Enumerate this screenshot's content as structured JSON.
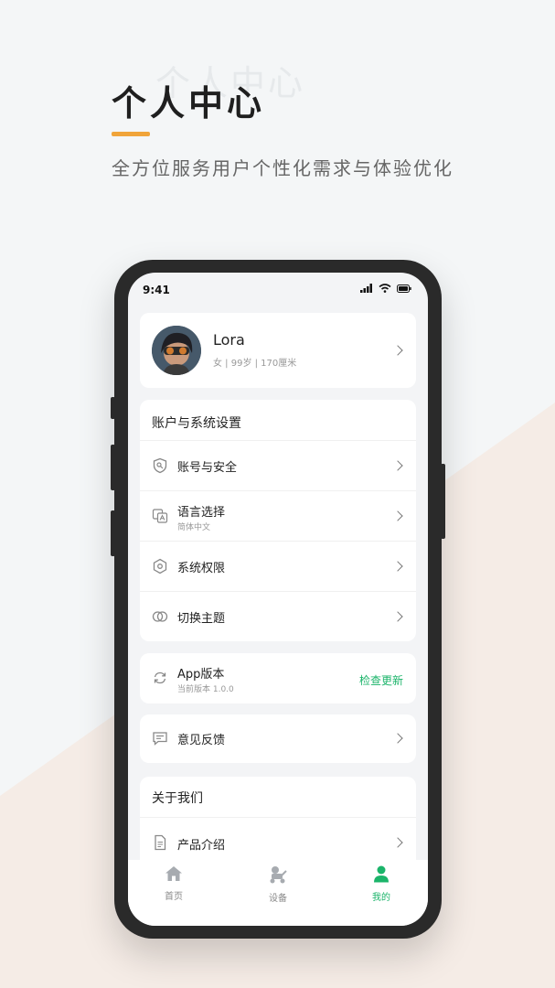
{
  "hero": {
    "ghost_title": "个人中心",
    "title": "个人中心",
    "subtitle": "全方位服务用户个性化需求与体验优化"
  },
  "status_bar": {
    "time": "9:41"
  },
  "profile": {
    "name": "Lora",
    "meta": "女 | 99岁 | 170厘米"
  },
  "settings": {
    "title": "账户与系统设置",
    "items": [
      {
        "label": "账号与安全",
        "icon": "shield-key-icon"
      },
      {
        "label": "语言选择",
        "sub": "简体中文",
        "icon": "translate-icon"
      },
      {
        "label": "系统权限",
        "icon": "hexagon-gear-icon"
      },
      {
        "label": "切换主题",
        "icon": "theme-toggle-icon"
      }
    ]
  },
  "app_version": {
    "label": "App版本",
    "sub": "当前版本 1.0.0",
    "action": "检查更新",
    "icon": "refresh-icon"
  },
  "feedback": {
    "label": "意见反馈",
    "icon": "message-icon"
  },
  "about": {
    "title": "关于我们",
    "items": [
      {
        "label": "产品介绍",
        "icon": "document-icon"
      }
    ]
  },
  "tabbar": {
    "tabs": [
      {
        "label": "首页",
        "icon": "home-icon"
      },
      {
        "label": "设备",
        "icon": "robot-device-icon"
      },
      {
        "label": "我的",
        "icon": "user-icon",
        "active": true
      }
    ]
  },
  "colors": {
    "accent": "#1bb46a",
    "hero_bar": "#f0a43a"
  }
}
